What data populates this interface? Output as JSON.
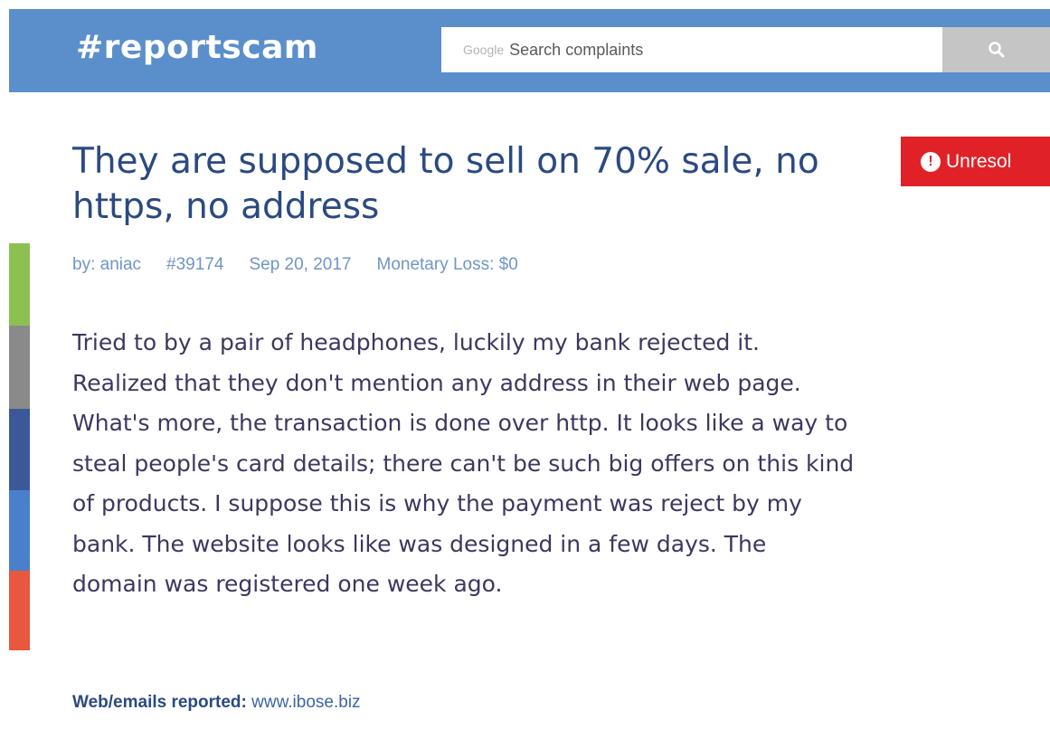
{
  "header": {
    "logo": "#reportscam",
    "search": {
      "brand": "Google",
      "placeholder": "Search complaints"
    },
    "search_button_icon": "search-icon"
  },
  "share_bar": {
    "colors": [
      "#8cc152",
      "#8a8a8a",
      "#3b5998",
      "#4a7fcb",
      "#e9573f"
    ]
  },
  "complaint": {
    "title": "They are supposed to sell on 70% sale, no https, no address",
    "status": {
      "icon": "exclamation-icon",
      "label": "Unresol",
      "color": "#e02228"
    },
    "meta": {
      "author": "by: aniac",
      "id": "#39174",
      "date": "Sep 20, 2017",
      "loss": "Monetary Loss: $0"
    },
    "lines": [
      "Tried to by a pair of headphones, luckily my bank rejected it.",
      "Realized that they don't mention any address in their web page.",
      "What's more, the transaction is done over http. It looks like a way to",
      "steal people's card details; there can't be such big offers on this kind",
      "of products. I suppose this is why the payment was reject by my",
      "bank. The website looks like was designed in a few days. The",
      "domain was registered one week ago."
    ],
    "reported": {
      "label": "Web/emails reported:",
      "value": "www.ibose.biz"
    }
  },
  "colors": {
    "header_bg": "#5a8fcb",
    "title": "#2a4a80",
    "meta": "#6f95c8",
    "body": "#3d3760"
  }
}
